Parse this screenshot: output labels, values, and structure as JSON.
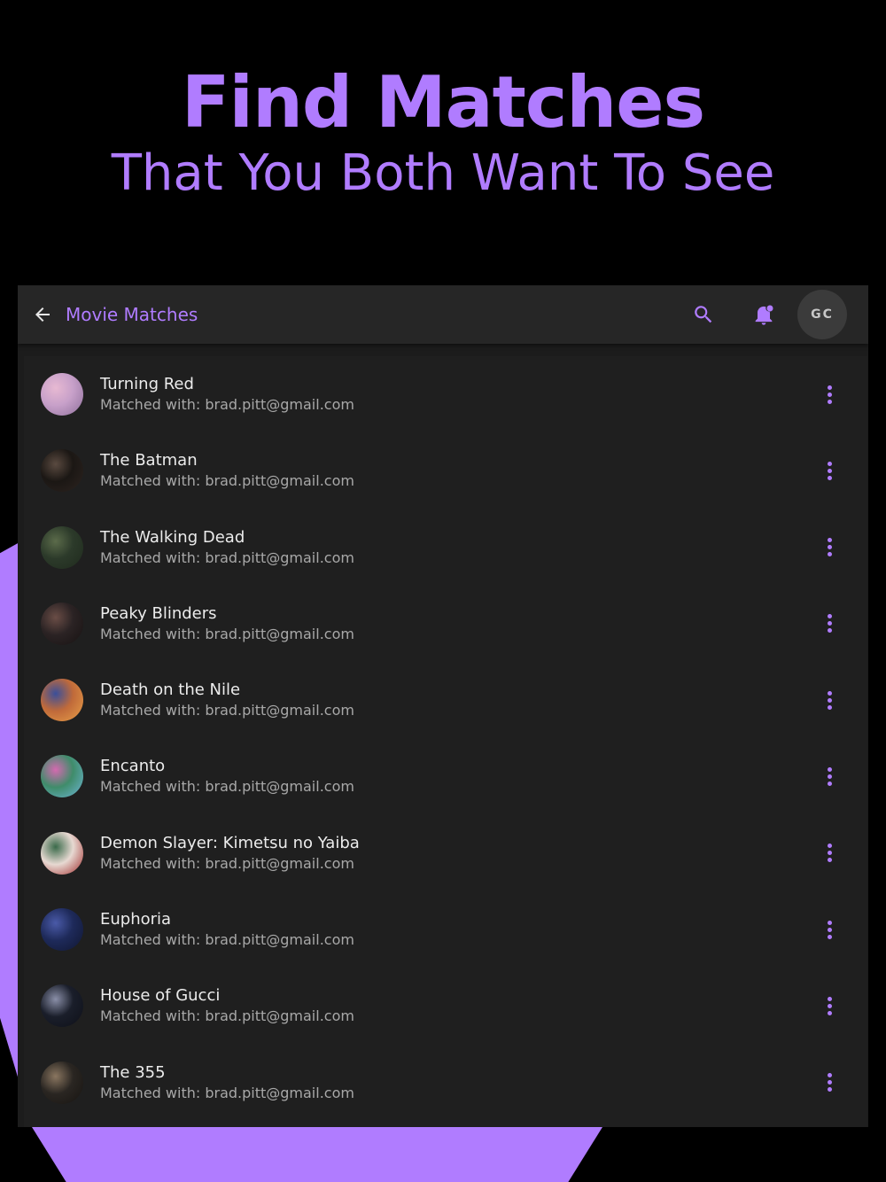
{
  "hero": {
    "title": "Find Matches",
    "subtitle": "That You Both Want To See"
  },
  "appbar": {
    "title": "Movie Matches",
    "avatar_initials": "GC",
    "back_icon": "arrow-left-icon",
    "search_icon": "search-icon",
    "notify_icon": "notification-bell-icon"
  },
  "colors": {
    "accent": "#b07cff",
    "background": "#000000",
    "surface": "#1f1f1f",
    "appbar": "#262626"
  },
  "matches": [
    {
      "title": "Turning Red",
      "subtitle": "Matched with: brad.pitt@gmail.com",
      "thumb_colors": [
        "#c7a0c9",
        "#e7b9d2",
        "#8d6e9a"
      ]
    },
    {
      "title": "The Batman",
      "subtitle": "Matched with: brad.pitt@gmail.com",
      "thumb_colors": [
        "#1b1714",
        "#5a4a40",
        "#2d2420"
      ]
    },
    {
      "title": "The Walking Dead",
      "subtitle": "Matched with: brad.pitt@gmail.com",
      "thumb_colors": [
        "#2c3a2a",
        "#5b6b4a",
        "#1f2a1d"
      ]
    },
    {
      "title": "Peaky Blinders",
      "subtitle": "Matched with: brad.pitt@gmail.com",
      "thumb_colors": [
        "#2b2324",
        "#6a4d46",
        "#171212"
      ]
    },
    {
      "title": "Death on the Nile",
      "subtitle": "Matched with: brad.pitt@gmail.com",
      "thumb_colors": [
        "#c06a3a",
        "#3a4f9a",
        "#e8a048"
      ]
    },
    {
      "title": "Encanto",
      "subtitle": "Matched with: brad.pitt@gmail.com",
      "thumb_colors": [
        "#3f8c6a",
        "#d46ab0",
        "#6fb6d8"
      ]
    },
    {
      "title": "Demon Slayer: Kimetsu no Yaiba",
      "subtitle": "Matched with: brad.pitt@gmail.com",
      "thumb_colors": [
        "#e7d9d2",
        "#3a6a4a",
        "#a02a2a"
      ]
    },
    {
      "title": "Euphoria",
      "subtitle": "Matched with: brad.pitt@gmail.com",
      "thumb_colors": [
        "#1e2a5a",
        "#4a5aa8",
        "#101630"
      ]
    },
    {
      "title": "House of Gucci",
      "subtitle": "Matched with: brad.pitt@gmail.com",
      "thumb_colors": [
        "#1a1e2a",
        "#8a8fa8",
        "#0e1018"
      ]
    },
    {
      "title": "The 355",
      "subtitle": "Matched with: brad.pitt@gmail.com",
      "thumb_colors": [
        "#2a2622",
        "#8a7660",
        "#171411"
      ]
    }
  ]
}
